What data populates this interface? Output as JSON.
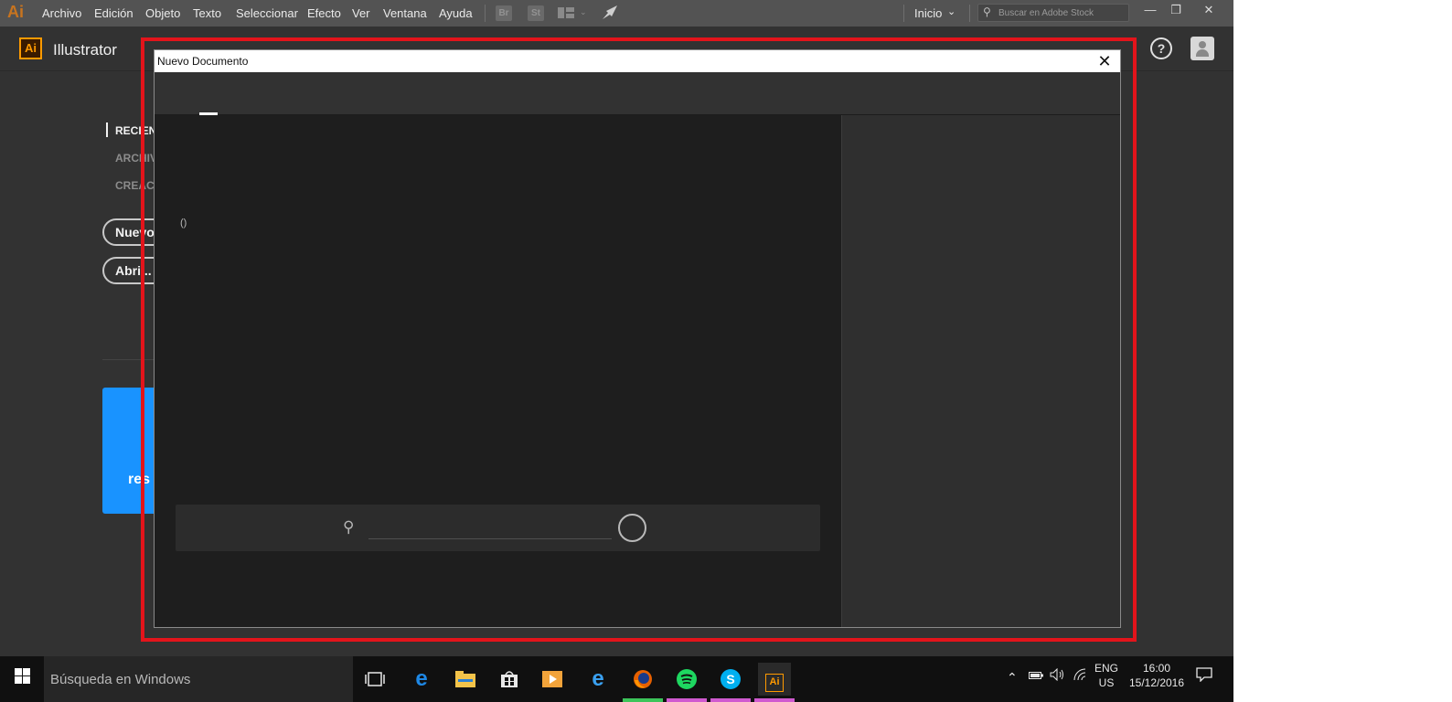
{
  "menubar": {
    "logo": "Ai",
    "items": [
      "Archivo",
      "Edición",
      "Objeto",
      "Texto",
      "Seleccionar",
      "Efecto",
      "Ver",
      "Ventana",
      "Ayuda"
    ],
    "bridge_label": "Br",
    "stock_label": "St",
    "workspace_label": "Inicio",
    "search_placeholder": "Buscar en Adobe Stock",
    "minimize": "—",
    "restore": "❐",
    "close": "✕"
  },
  "app_header": {
    "logo": "Ai",
    "app_name": "Illustrator",
    "help": "?"
  },
  "start_screen": {
    "sidebar": [
      "RECIEN",
      "ARCHIV",
      "CREAC"
    ],
    "new_button": "Nuevo",
    "open_button": "Abri...",
    "promo_text": "res"
  },
  "dialog": {
    "title": "Nuevo Documento",
    "close": "✕",
    "items_count": "()",
    "search_value": ""
  },
  "taskbar": {
    "search_placeholder": "Búsqueda en Windows",
    "apps": [
      "task-view",
      "edge",
      "file-explorer",
      "store",
      "media-player",
      "internet-explorer",
      "firefox",
      "spotify",
      "skype",
      "illustrator"
    ],
    "illustrator_label": "Ai",
    "language": "ENG",
    "region": "US",
    "time": "16:00",
    "date": "15/12/2016"
  },
  "colors": {
    "highlight": "#e3141b",
    "ai_orange": "#ff9a00",
    "promo_blue": "#1993ff",
    "firefox_run": "#3cc45a",
    "pink_run": "#d05ad0"
  }
}
